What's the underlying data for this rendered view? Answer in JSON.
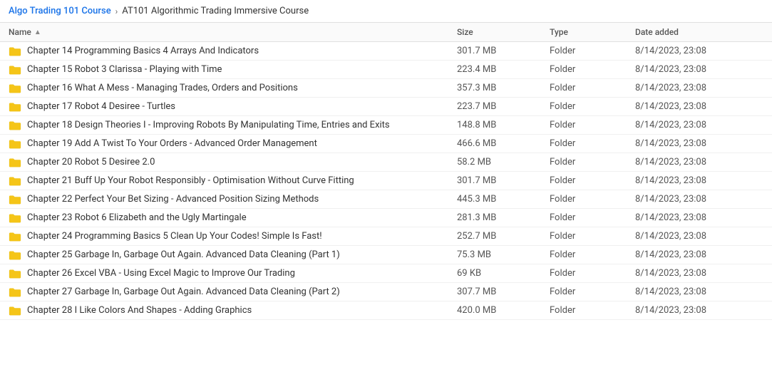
{
  "breadcrumb": {
    "root": "Algo Trading 101 Course",
    "separator": "›",
    "current": "AT101 Algorithmic Trading Immersive Course"
  },
  "table": {
    "headers": {
      "name": "Name",
      "size": "Size",
      "type": "Type",
      "date": "Date added"
    },
    "rows": [
      {
        "name": "Chapter 14 Programming Basics 4 Arrays And Indicators",
        "size": "301.7 MB",
        "type": "Folder",
        "date": "8/14/2023, 23:08"
      },
      {
        "name": "Chapter 15 Robot 3 Clarissa - Playing with Time",
        "size": "223.4 MB",
        "type": "Folder",
        "date": "8/14/2023, 23:08"
      },
      {
        "name": "Chapter 16 What A Mess - Managing Trades, Orders and Positions",
        "size": "357.3 MB",
        "type": "Folder",
        "date": "8/14/2023, 23:08"
      },
      {
        "name": "Chapter 17 Robot 4 Desiree - Turtles",
        "size": "223.7 MB",
        "type": "Folder",
        "date": "8/14/2023, 23:08"
      },
      {
        "name": "Chapter 18 Design Theories I - Improving Robots By Manipulating Time, Entries and Exits",
        "size": "148.8 MB",
        "type": "Folder",
        "date": "8/14/2023, 23:08"
      },
      {
        "name": "Chapter 19 Add A Twist To Your Orders - Advanced Order Management",
        "size": "466.6 MB",
        "type": "Folder",
        "date": "8/14/2023, 23:08"
      },
      {
        "name": "Chapter 20 Robot 5 Desiree 2.0",
        "size": "58.2 MB",
        "type": "Folder",
        "date": "8/14/2023, 23:08"
      },
      {
        "name": "Chapter 21 Buff Up Your Robot Responsibly - Optimisation Without Curve Fitting",
        "size": "301.7 MB",
        "type": "Folder",
        "date": "8/14/2023, 23:08"
      },
      {
        "name": "Chapter 22 Perfect Your Bet Sizing - Advanced Position Sizing Methods",
        "size": "445.3 MB",
        "type": "Folder",
        "date": "8/14/2023, 23:08"
      },
      {
        "name": "Chapter 23 Robot 6 Elizabeth and the Ugly Martingale",
        "size": "281.3 MB",
        "type": "Folder",
        "date": "8/14/2023, 23:08"
      },
      {
        "name": "Chapter 24 Programming Basics 5 Clean Up Your Codes! Simple Is Fast!",
        "size": "252.7 MB",
        "type": "Folder",
        "date": "8/14/2023, 23:08"
      },
      {
        "name": "Chapter 25 Garbage In, Garbage Out Again. Advanced Data Cleaning (Part 1)",
        "size": "75.3 MB",
        "type": "Folder",
        "date": "8/14/2023, 23:08"
      },
      {
        "name": "Chapter 26 Excel VBA - Using Excel Magic to Improve Our Trading",
        "size": "69 KB",
        "type": "Folder",
        "date": "8/14/2023, 23:08"
      },
      {
        "name": "Chapter 27 Garbage In, Garbage Out Again. Advanced Data Cleaning (Part 2)",
        "size": "307.7 MB",
        "type": "Folder",
        "date": "8/14/2023, 23:08"
      },
      {
        "name": "Chapter 28 I Like Colors And Shapes - Adding Graphics",
        "size": "420.0 MB",
        "type": "Folder",
        "date": "8/14/2023, 23:08"
      }
    ]
  },
  "colors": {
    "folder": "#f5c518",
    "accent": "#1a73e8"
  }
}
